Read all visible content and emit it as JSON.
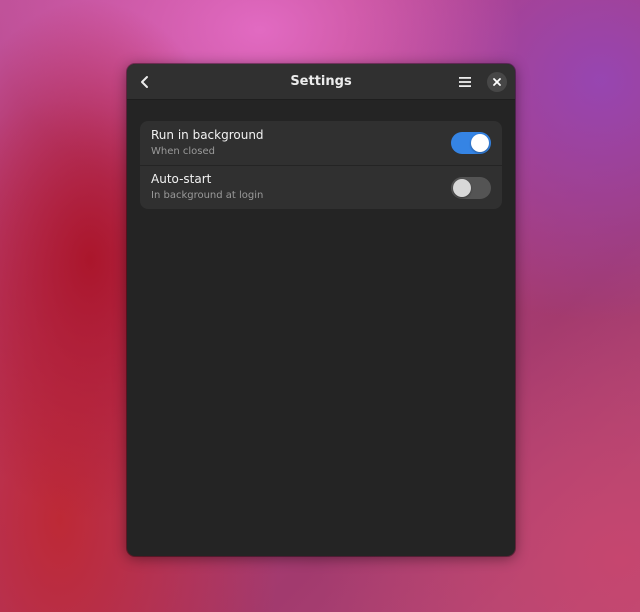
{
  "window": {
    "title": "Settings",
    "back_icon": "chevron-left-icon",
    "menu_icon": "hamburger-menu-icon",
    "close_icon": "close-icon"
  },
  "settings": [
    {
      "title": "Run in background",
      "subtitle": "When closed",
      "enabled": true
    },
    {
      "title": "Auto-start",
      "subtitle": "In background at login",
      "enabled": false
    }
  ],
  "colors": {
    "accent": "#3584e4",
    "window_bg": "#242424",
    "headerbar_bg": "#303030",
    "row_bg": "#303030",
    "switch_off": "#545454"
  }
}
